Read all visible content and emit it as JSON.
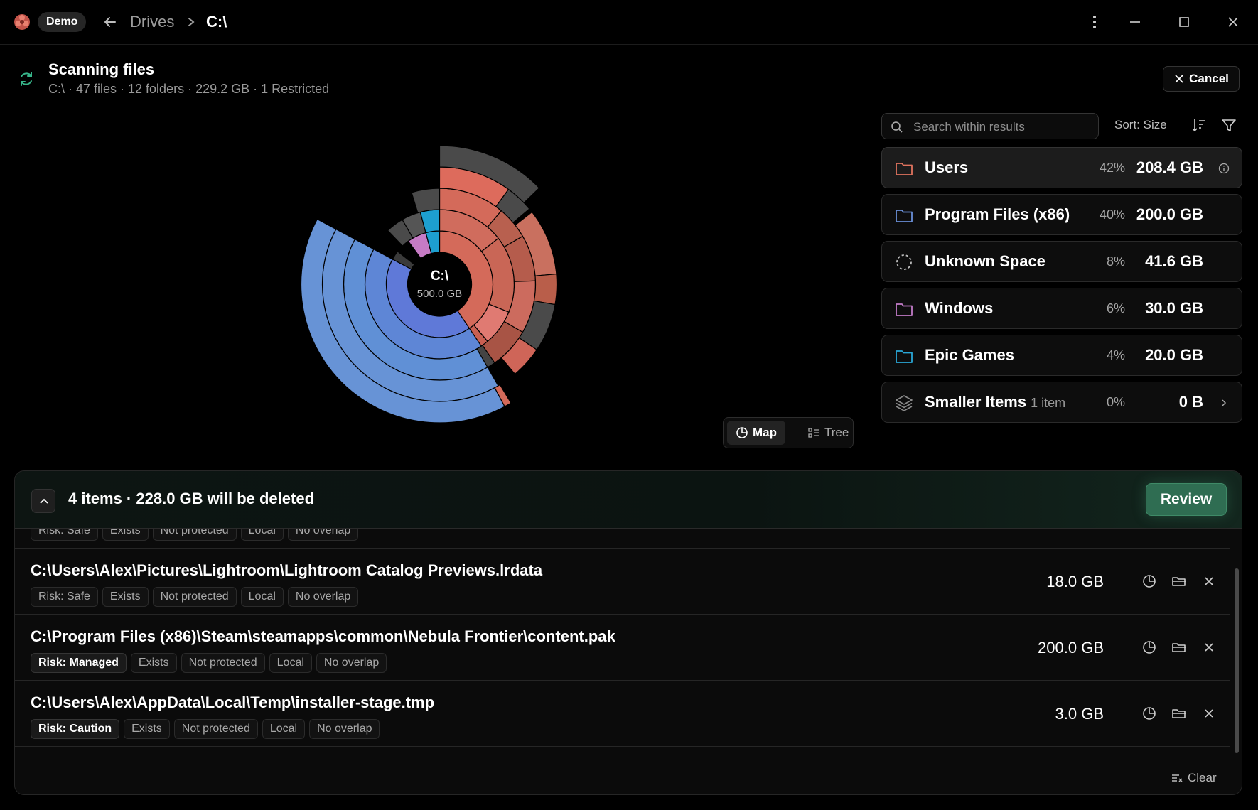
{
  "titlebar": {
    "badge": "Demo",
    "breadcrumb": {
      "parent": "Drives",
      "current": "C:\\"
    }
  },
  "scan": {
    "title": "Scanning files",
    "subtitle": "C:\\ · 47 files · 12 folders · 229.2 GB · 1 Restricted",
    "cancel_label": "Cancel"
  },
  "chart_center": {
    "label": "C:\\",
    "size": "500.0 GB"
  },
  "results": {
    "search_placeholder": "Search within results",
    "sort_label": "Sort: Size",
    "rows": [
      {
        "name": "Users",
        "percent": "42%",
        "size": "208.4 GB",
        "icon": "folder-icon",
        "color": "#e0735e"
      },
      {
        "name": "Program Files (x86)",
        "percent": "40%",
        "size": "200.0 GB",
        "icon": "folder-icon",
        "color": "#6a8fd8"
      },
      {
        "name": "Unknown Space",
        "percent": "8%",
        "size": "41.6 GB",
        "icon": "dashed-circle-icon",
        "color": "#9a9a9a"
      },
      {
        "name": "Windows",
        "percent": "6%",
        "size": "30.0 GB",
        "icon": "folder-icon",
        "color": "#c27bc8"
      },
      {
        "name": "Epic Games",
        "percent": "4%",
        "size": "20.0 GB",
        "icon": "folder-icon",
        "color": "#2aa7d6"
      },
      {
        "name": "Smaller Items",
        "count": "1 item",
        "percent": "0%",
        "size": "0 B",
        "icon": "layers-icon",
        "color": "#8a8a8a"
      }
    ]
  },
  "view_toggle": {
    "map_label": "Map",
    "tree_label": "Tree",
    "active": "Map"
  },
  "deletion": {
    "title": "4 items · 228.0 GB will be deleted",
    "review_label": "Review",
    "clear_label": "Clear",
    "items": [
      {
        "path": "",
        "size": "",
        "chips": [
          "Risk: Safe",
          "Exists",
          "Not protected",
          "Local",
          "No overlap"
        ]
      },
      {
        "path": "C:\\Users\\Alex\\Pictures\\Lightroom\\Lightroom Catalog Previews.lrdata",
        "size": "18.0 GB",
        "chips": [
          "Risk: Safe",
          "Exists",
          "Not protected",
          "Local",
          "No overlap"
        ]
      },
      {
        "path": "C:\\Program Files (x86)\\Steam\\steamapps\\common\\Nebula Frontier\\content.pak",
        "size": "200.0 GB",
        "chips": [
          "Risk: Managed",
          "Exists",
          "Not protected",
          "Local",
          "No overlap"
        ]
      },
      {
        "path": "C:\\Users\\Alex\\AppData\\Local\\Temp\\installer-stage.tmp",
        "size": "3.0 GB",
        "chips": [
          "Risk: Caution",
          "Exists",
          "Not protected",
          "Local",
          "No overlap"
        ]
      }
    ]
  },
  "colors": {
    "accent_green": "#2f6d52",
    "users_red": "#d4675a",
    "program_blue": "#6a8fd8",
    "windows_pink": "#c27bc8",
    "epic_cyan": "#1fa0d0",
    "unknown_gray": "#555555"
  }
}
